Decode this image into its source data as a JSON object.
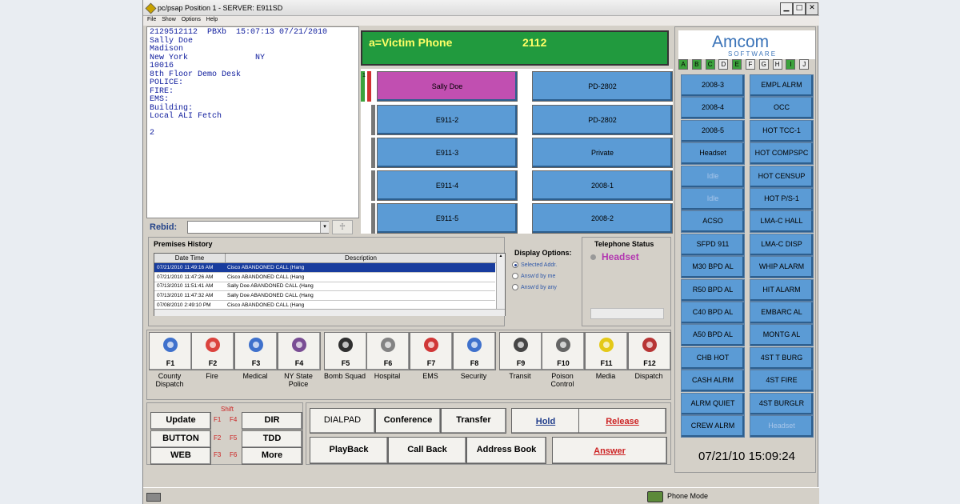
{
  "window": {
    "title": "pc/psap   Position 1  - SERVER: E911SD",
    "min_glyph": "▁",
    "max_glyph": "□",
    "close_glyph": "✕"
  },
  "menu": [
    "File",
    "Show",
    "Options",
    "Help"
  ],
  "ali": {
    "text": "2129512112  PBXb  15:07:13 07/21/2010\nSally Doe\nMadison\nNew York              NY\n10016\n8th Floor Demo Desk\nPOLICE:\nFIRE:\nEMS:\nBuilding:\nLocal ALI Fetch\n\n2"
  },
  "rebid": {
    "label": "Rebid:",
    "value": "",
    "arrow": "▾",
    "button_glyph": "♰"
  },
  "victim": {
    "label": "a=Victim Phone",
    "number": "2112"
  },
  "lines": {
    "left": [
      "Sally Doe",
      "E911-2",
      "E911-3",
      "E911-4",
      "E911-5"
    ],
    "right": [
      "PD-2802",
      "PD-2802",
      "Private",
      "2008-1",
      "2008-2"
    ],
    "active_number": "1"
  },
  "logo": {
    "name": "Amcom",
    "sub": "SOFTWARE"
  },
  "tabs": [
    "A",
    "B",
    "C",
    "D",
    "E",
    "F",
    "G",
    "H",
    "I",
    "J"
  ],
  "tab_active": [
    "A",
    "B",
    "C",
    "E",
    "I"
  ],
  "speed_left": [
    "2008-3",
    "2008-4",
    "2008-5",
    "Headset",
    "Idle",
    "Idle",
    "ACSO",
    "SFPD 911",
    "M30 BPD AL",
    "R50 BPD AL",
    "C40 BPD AL",
    "A50 BPD AL",
    "CHB HOT",
    "CASH ALRM",
    "ALRM QUIET",
    "CREW ALRM"
  ],
  "speed_right": [
    "EMPL ALRM",
    "OCC",
    "HOT TCC-1",
    "HOT COMPSPC",
    "HOT CENSUP",
    "HOT P/S-1",
    "LMA-C HALL",
    "LMA-C DISP",
    "WHIP ALARM",
    "HIT ALARM",
    "EMBARC AL",
    "MONTG AL",
    "4ST T BURG",
    "4ST FIRE",
    "4ST BURGLR",
    "Headset"
  ],
  "speed_idle": [
    "Idle",
    "Idle"
  ],
  "clock": "07/21/10  15:09:24",
  "history": {
    "title": "Premises History",
    "headers": [
      "Date Time",
      "Description"
    ],
    "rows": [
      [
        "07/21/2010 11:49:16 AM",
        "Cisco ABANDONED CALL (Hang"
      ],
      [
        "07/21/2010 11:47:26 AM",
        "Cisco ABANDONED CALL (Hang"
      ],
      [
        "07/13/2010 11:51:41 AM",
        "Sally Doe ABANDONED CALL (Hang"
      ],
      [
        "07/13/2010 11:47:32 AM",
        "Sally Doe ABANDONED CALL (Hang"
      ],
      [
        "07/08/2010 2:49:10 PM",
        "Cisco ABANDONED CALL (Hang"
      ]
    ],
    "scroll_up": "▲",
    "scroll_down": "▼"
  },
  "display_options": {
    "title": "Display Options:",
    "options": [
      "Selected Addr.",
      "Answ'd by me",
      "Answ'd by any"
    ]
  },
  "telephone_status": {
    "title": "Telephone Status",
    "state": "Headset"
  },
  "fkeys": [
    {
      "key": "F1",
      "label": "County Dispatch",
      "icon": "star-of-life-icon",
      "color": "#2b63c8"
    },
    {
      "key": "F2",
      "label": "Fire",
      "icon": "maltese-cross-icon",
      "color": "#d8302a"
    },
    {
      "key": "F3",
      "label": "Medical",
      "icon": "star-of-life-icon",
      "color": "#2b63c8"
    },
    {
      "key": "F4",
      "label": "NY State Police",
      "icon": "police-seal-icon",
      "color": "#6b3b8a"
    },
    {
      "key": "F5",
      "label": "Bomb Squad",
      "icon": "bomb-icon",
      "color": "#1a1a1a"
    },
    {
      "key": "F6",
      "label": "Hospital",
      "icon": "caduceus-icon",
      "color": "#777777"
    },
    {
      "key": "F7",
      "label": "EMS",
      "icon": "ambulance-icon",
      "color": "#cc2222"
    },
    {
      "key": "F8",
      "label": "Security",
      "icon": "security-badge-icon",
      "color": "#2b63c8"
    },
    {
      "key": "F9",
      "label": "Transit",
      "icon": "train-icon",
      "color": "#333333"
    },
    {
      "key": "F10",
      "label": "Poison Control",
      "icon": "skull-icon",
      "color": "#555555"
    },
    {
      "key": "F11",
      "label": "Media",
      "icon": "radiation-icon",
      "color": "#e2c400"
    },
    {
      "key": "F12",
      "label": "Dispatch",
      "icon": "seal-icon",
      "color": "#b02020"
    }
  ],
  "bottom_left": {
    "shift": "Shift",
    "rows": [
      {
        "left": "Update",
        "k1": "F1",
        "k2": "F4",
        "right": "DIR"
      },
      {
        "left": "BUTTON",
        "k1": "F2",
        "k2": "F5",
        "right": "TDD"
      },
      {
        "left": "WEB",
        "k1": "F3",
        "k2": "F6",
        "right": "More"
      }
    ]
  },
  "bottom_mid": {
    "dialpad": "DIALPAD",
    "conference": "Conference",
    "transfer": "Transfer",
    "hold": "Hold",
    "release": "Release",
    "playback": "PlayBack",
    "callback": "Call Back",
    "addressbook": "Address Book",
    "answer": "Answer"
  },
  "status": {
    "mode": "Phone Mode"
  },
  "colors": {
    "line_blue": "#5b9bd5",
    "active_line": "#c14fb1",
    "victim_bg": "#219a3e",
    "victim_text": "#ffff66"
  }
}
